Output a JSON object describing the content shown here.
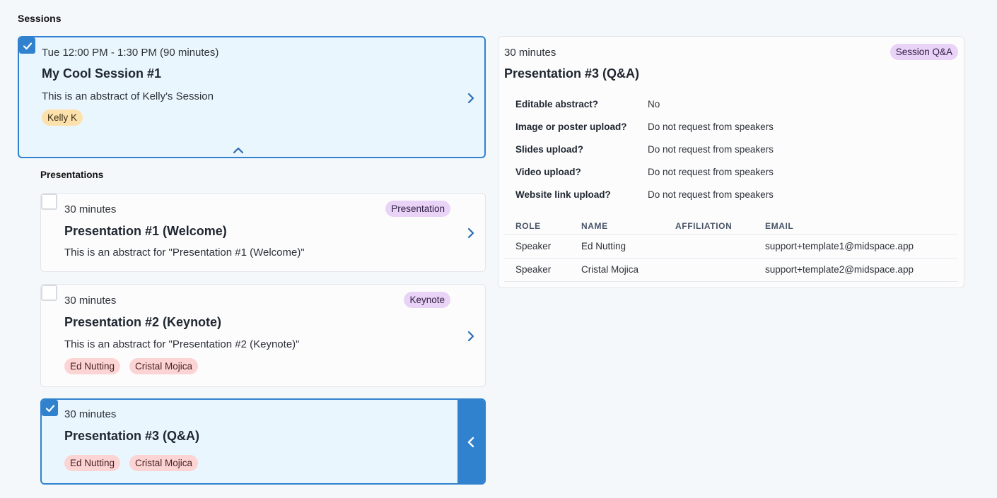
{
  "sessions_heading": "Sessions",
  "presentations_heading": "Presentations",
  "session": {
    "time": "Tue 12:00 PM - 1:30 PM (90 minutes)",
    "title": "My Cool Session #1",
    "abstract": "This is an abstract of Kelly's Session",
    "people": [
      "Kelly K"
    ],
    "checked": true
  },
  "presentations": [
    {
      "duration": "30 minutes",
      "title": "Presentation #1 (Welcome)",
      "abstract": "This is an abstract for \"Presentation #1 (Welcome)\"",
      "type_badge": "Presentation",
      "people": [],
      "checked": false
    },
    {
      "duration": "30 minutes",
      "title": "Presentation #2 (Keynote)",
      "abstract": "This is an abstract for \"Presentation #2 (Keynote)\"",
      "type_badge": "Keynote",
      "people": [
        "Ed Nutting",
        "Cristal Mojica"
      ],
      "checked": false
    },
    {
      "duration": "30 minutes",
      "title": "Presentation #3 (Q&A)",
      "people": [
        "Ed Nutting",
        "Cristal Mojica"
      ],
      "checked": true
    }
  ],
  "detail": {
    "duration": "30 minutes",
    "title": "Presentation #3 (Q&A)",
    "type_badge": "Session Q&A",
    "fields": [
      {
        "label": "Editable abstract?",
        "value": "No"
      },
      {
        "label": "Image or poster upload?",
        "value": "Do not request from speakers"
      },
      {
        "label": "Slides upload?",
        "value": "Do not request from speakers"
      },
      {
        "label": "Video upload?",
        "value": "Do not request from speakers"
      },
      {
        "label": "Website link upload?",
        "value": "Do not request from speakers"
      }
    ],
    "table": {
      "headers": [
        "ROLE",
        "NAME",
        "AFFILIATION",
        "EMAIL"
      ],
      "rows": [
        {
          "role": "Speaker",
          "name": "Ed Nutting",
          "affiliation": "",
          "email": "support+template1@midspace.app"
        },
        {
          "role": "Speaker",
          "name": "Cristal Mojica",
          "affiliation": "",
          "email": "support+template2@midspace.app"
        }
      ]
    }
  },
  "colors": {
    "accent": "#3182ce",
    "selected_bg": "#eaf6fd",
    "tag_orange": "#fde1ad",
    "tag_red": "#fcd4d4",
    "tag_purple": "#e9d4f8"
  },
  "icons": {
    "check": "check-icon",
    "chevron_right": "chevron-right-icon",
    "chevron_up": "chevron-up-icon",
    "chevron_left": "chevron-left-icon"
  }
}
